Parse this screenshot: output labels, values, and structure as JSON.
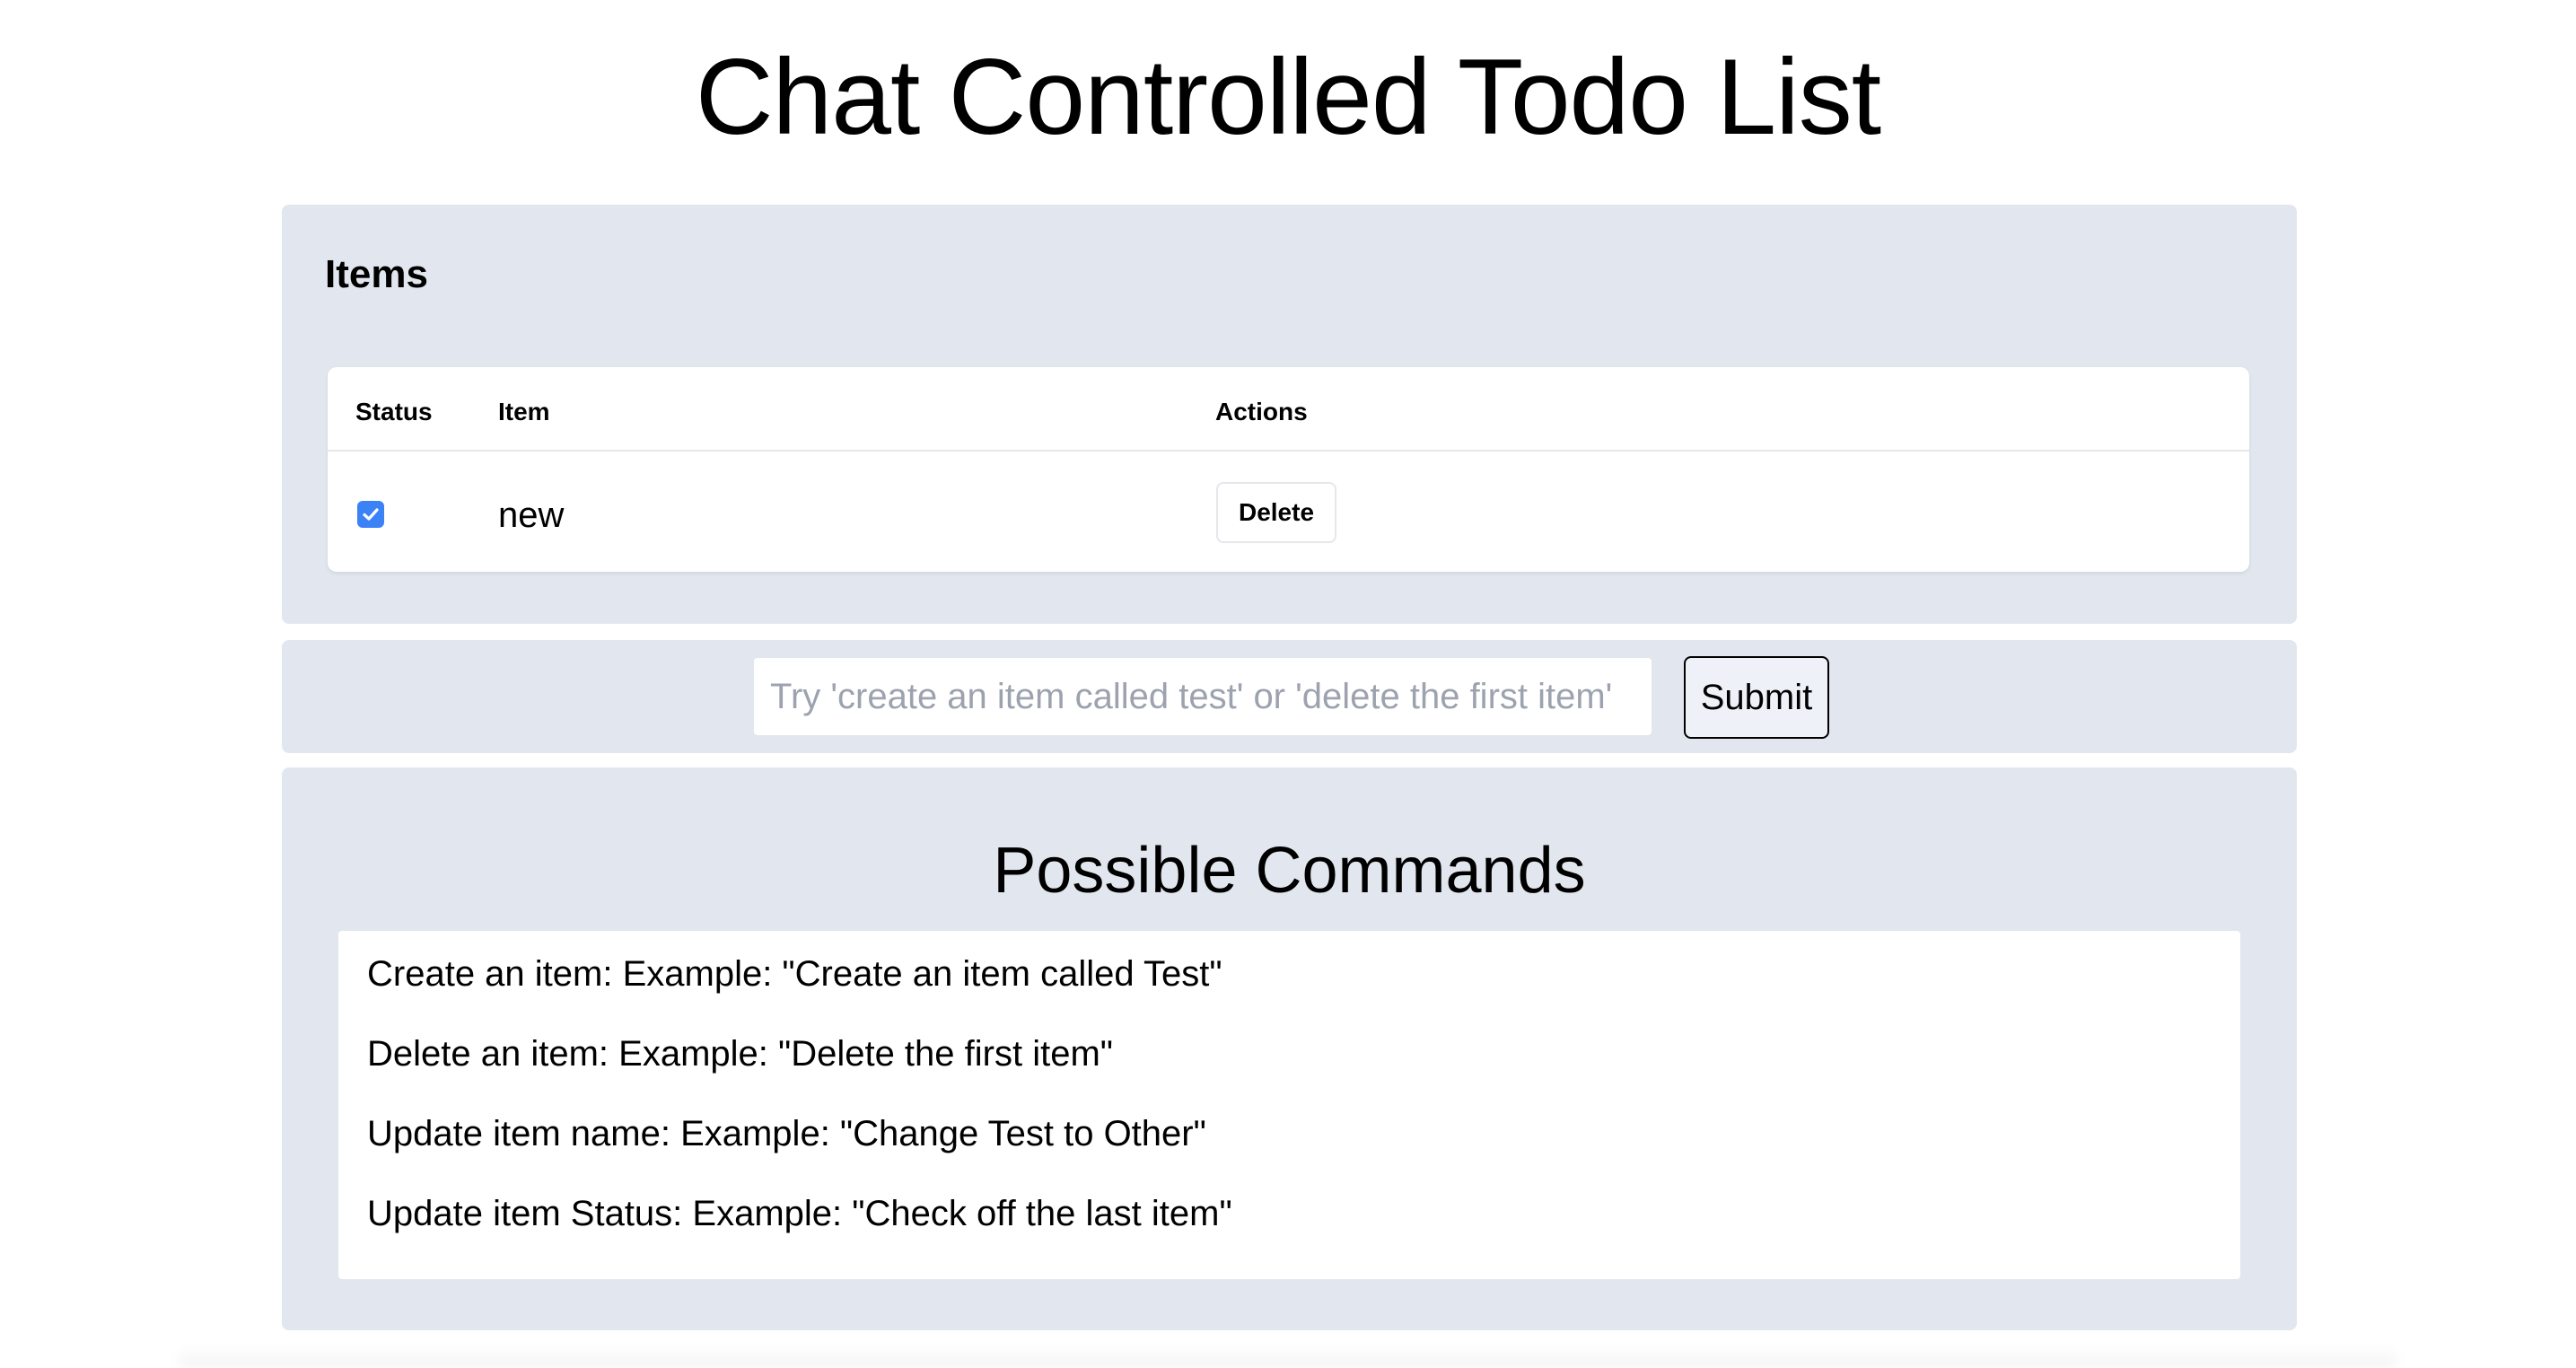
{
  "page": {
    "title": "Chat Controlled Todo List"
  },
  "items_panel": {
    "heading": "Items",
    "columns": {
      "status": "Status",
      "item": "Item",
      "actions": "Actions"
    },
    "rows": [
      {
        "checked": true,
        "name": "new",
        "delete_label": "Delete"
      }
    ]
  },
  "chat": {
    "input_value": "",
    "placeholder": "Try 'create an item called test' or 'delete the first item'",
    "submit_label": "Submit"
  },
  "commands": {
    "heading": "Possible Commands",
    "items": [
      "Create an item: Example: \"Create an item called Test\"",
      "Delete an item: Example: \"Delete the first item\"",
      "Update item name: Example: \"Change Test to Other\"",
      "Update item Status: Example: \"Check off the last item\""
    ]
  },
  "colors": {
    "panel_background": "#e2e6ee",
    "checkbox_accent": "#3b82f6",
    "placeholder_text": "#9ca3af"
  },
  "icons": {
    "checkbox_checked": "checkmark-icon"
  }
}
